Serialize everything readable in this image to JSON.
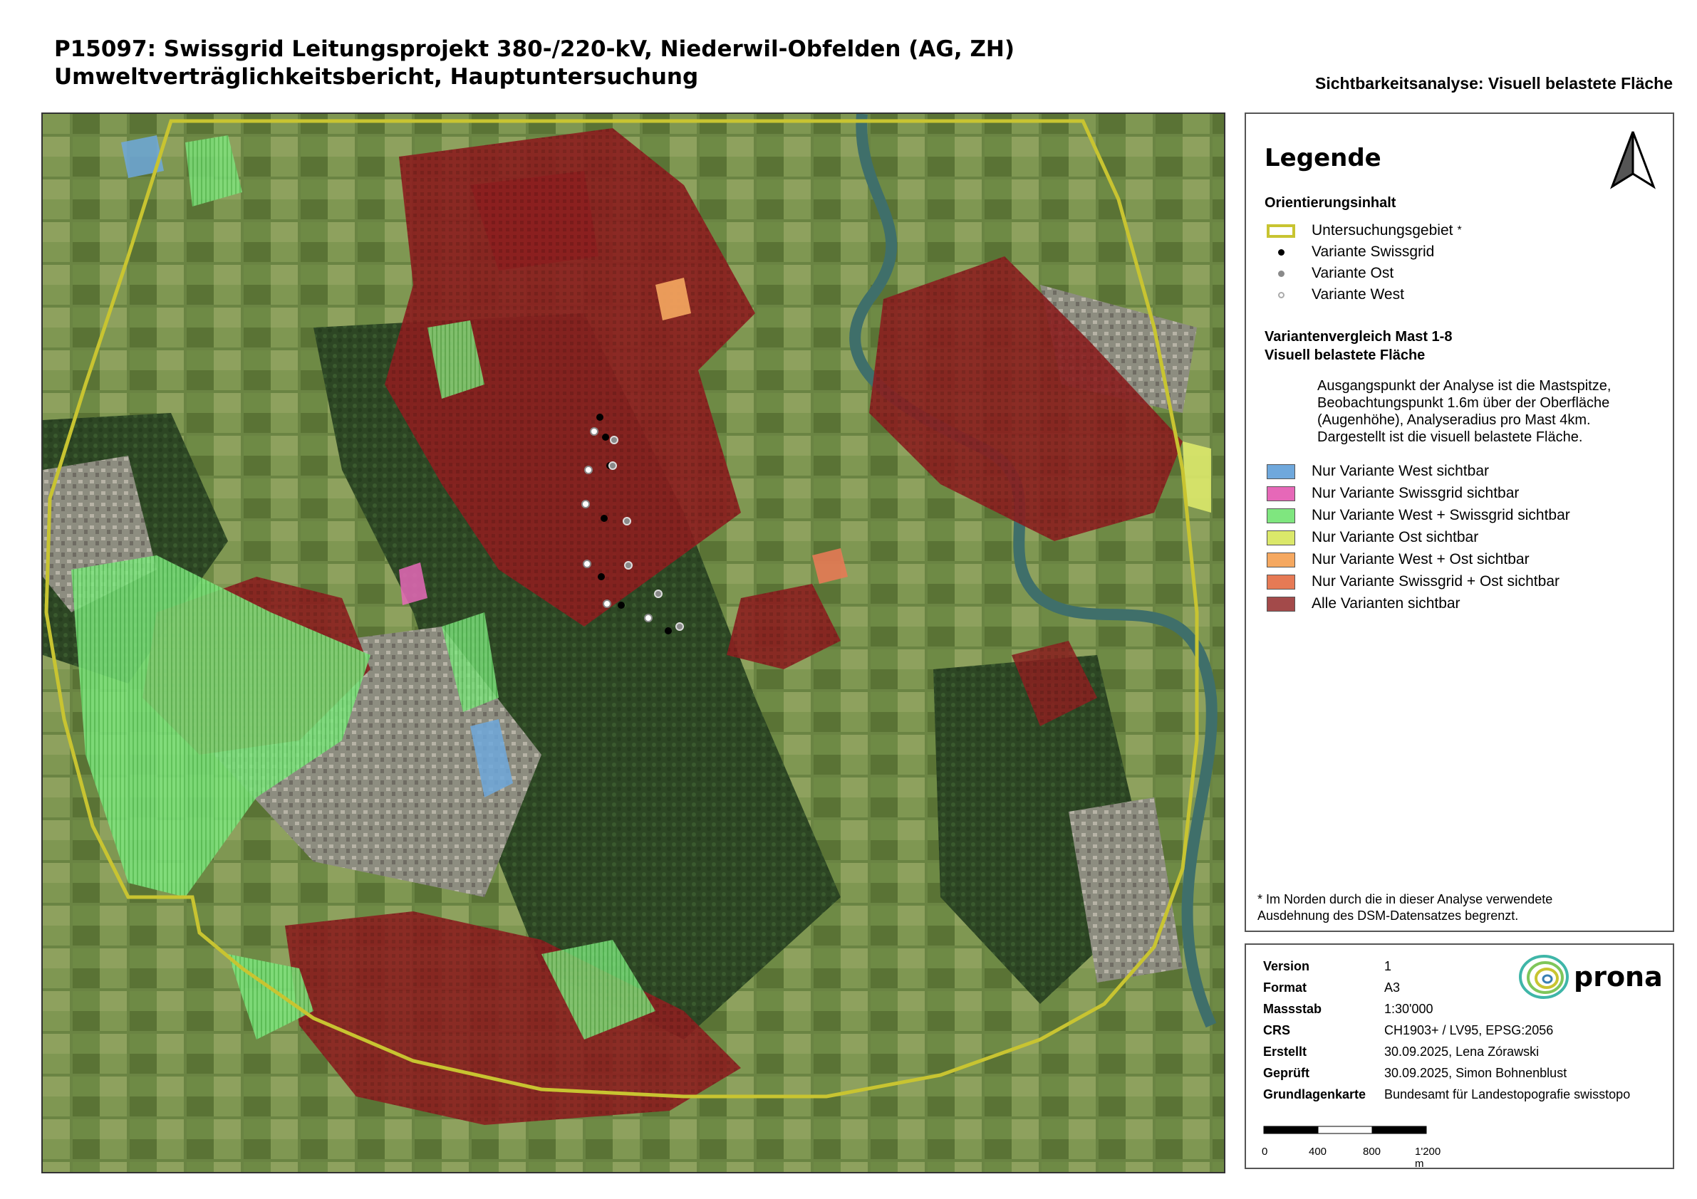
{
  "title": {
    "line1": "P15097:  Swissgrid Leitungsprojekt 380-/220-kV, Niederwil-Obfelden (AG, ZH)",
    "line2": "Umweltverträglichkeitsbericht, Hauptuntersuchung"
  },
  "map_subtitle": "Sichtbarkeitsanalyse: Visuell belastete Fläche",
  "legend": {
    "heading": "Legende",
    "section1": "Orientierungsinhalt",
    "items1": [
      {
        "label": "Untersuchungsgebiet",
        "suffix": "*",
        "symbol": "outline",
        "color": "#c8c431"
      },
      {
        "label": "Variante Swissgrid",
        "symbol": "dot",
        "color": "#000000"
      },
      {
        "label": "Variante Ost",
        "symbol": "dot",
        "color": "#8a8a8a"
      },
      {
        "label": "Variante West",
        "symbol": "ring",
        "color": "#aaaaaa"
      }
    ],
    "section2_line1": "Variantenvergleich Mast 1-8",
    "section2_line2": "Visuell belastete Fläche",
    "description": "Ausgangspunkt der Analyse ist die Mastspitze, Beobachtungspunkt 1.6m über der Oberfläche (Augenhöhe), Analyseradius pro Mast 4km. Dargestellt ist die visuell belastete Fläche.",
    "items2": [
      {
        "label": "Nur Variante West sichtbar",
        "color": "#6fa8dc"
      },
      {
        "label": "Nur Variante Swissgrid sichtbar",
        "color": "#e668b8"
      },
      {
        "label": "Nur Variante West + Swissgrid sichtbar",
        "color": "#7fe67f"
      },
      {
        "label": "Nur Variante Ost sichtbar",
        "color": "#dbe86a"
      },
      {
        "label": "Nur Variante West + Ost sichtbar",
        "color": "#f5a860"
      },
      {
        "label": "Nur Variante Swissgrid + Ost sichtbar",
        "color": "#e67a55"
      },
      {
        "label": "Alle Varianten sichtbar",
        "color": "#a34a4a"
      }
    ],
    "footnote_line1": "* Im Norden durch die in dieser Analyse verwendete",
    "footnote_line2": "Ausdehnung des DSM-Datensatzes begrenzt."
  },
  "metadata": {
    "rows": [
      {
        "key": "Version",
        "value": "1"
      },
      {
        "key": "Format",
        "value": "A3"
      },
      {
        "key": "Massstab",
        "value": "1:30'000"
      },
      {
        "key": "CRS",
        "value": "CH1903+ / LV95, EPSG:2056"
      },
      {
        "key": "Erstellt",
        "value": "30.09.2025, Lena Zórawski"
      },
      {
        "key": "Geprüft",
        "value": "30.09.2025, Simon Bohnenblust"
      },
      {
        "key": "Grundlagenkarte",
        "value": "Bundesamt für Landestopografie swisstopo"
      }
    ],
    "logo_text": "prona",
    "scale_labels": [
      "0",
      "400",
      "800",
      "1'200 m"
    ]
  },
  "colors": {
    "all_visible": "#8b1f1f",
    "west_swissgrid": "#7fe67f",
    "forest": "#2f4a25",
    "field": "#5d7a3a",
    "boundary": "#c8c431"
  }
}
